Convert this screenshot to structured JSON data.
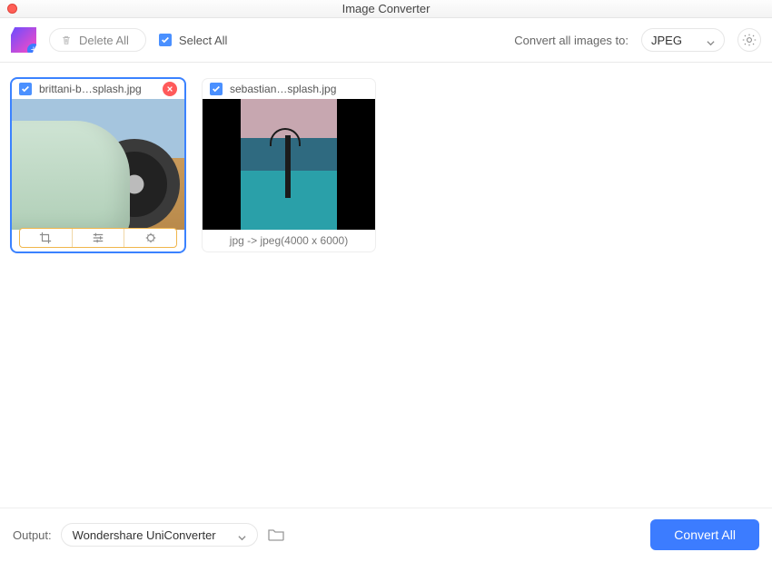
{
  "window": {
    "title": "Image Converter"
  },
  "toolbar": {
    "delete_label": "Delete All",
    "select_all_label": "Select All",
    "select_all_checked": true,
    "convert_to_label": "Convert all images to:",
    "format_value": "JPEG"
  },
  "cards": [
    {
      "checked": true,
      "filename": "brittani-b…splash.jpg",
      "active": true,
      "show_remove": true,
      "meta": ""
    },
    {
      "checked": true,
      "filename": "sebastian…splash.jpg",
      "active": false,
      "show_remove": false,
      "meta": "jpg -> jpeg(4000 x 6000)"
    }
  ],
  "bottom": {
    "output_label": "Output:",
    "output_value": "Wondershare UniConverter",
    "convert_label": "Convert All"
  }
}
